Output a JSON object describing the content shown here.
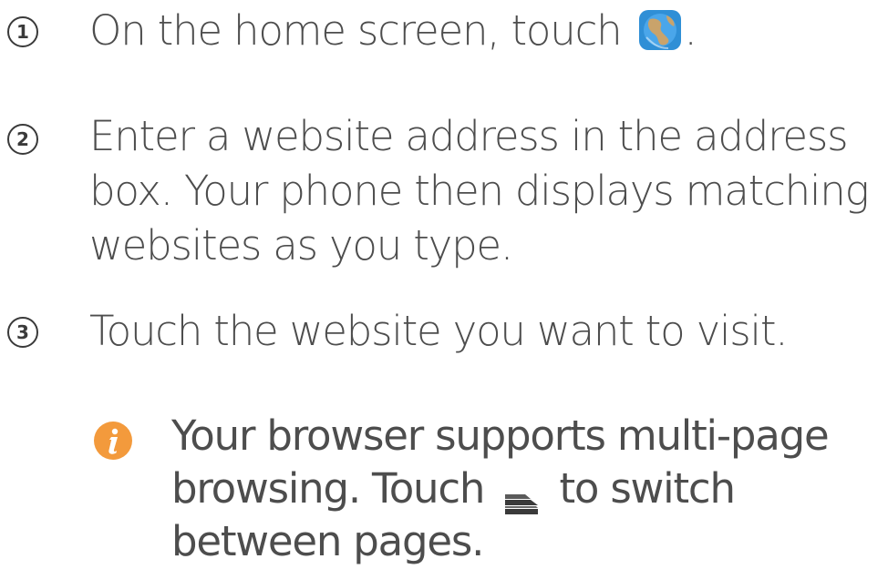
{
  "steps": [
    {
      "number": "1",
      "text_before": "On the home screen, touch",
      "icon": "browser-globe-icon",
      "text_after": "."
    },
    {
      "number": "2",
      "text": "Enter a website address in the address box. Your phone then displays matching websites as you type."
    },
    {
      "number": "3",
      "text": "Touch the website you want to visit."
    }
  ],
  "note": {
    "icon": "info-icon",
    "text_before": "Your browser supports multi-page browsing. Touch",
    "icon_inline": "tabs-stack-icon",
    "text_after": "to switch between pages."
  },
  "colors": {
    "text": "#4d4d4d",
    "info_icon": "#f39a3c",
    "globe_blue": "#2f8fd6",
    "globe_land": "#c9a36b"
  }
}
